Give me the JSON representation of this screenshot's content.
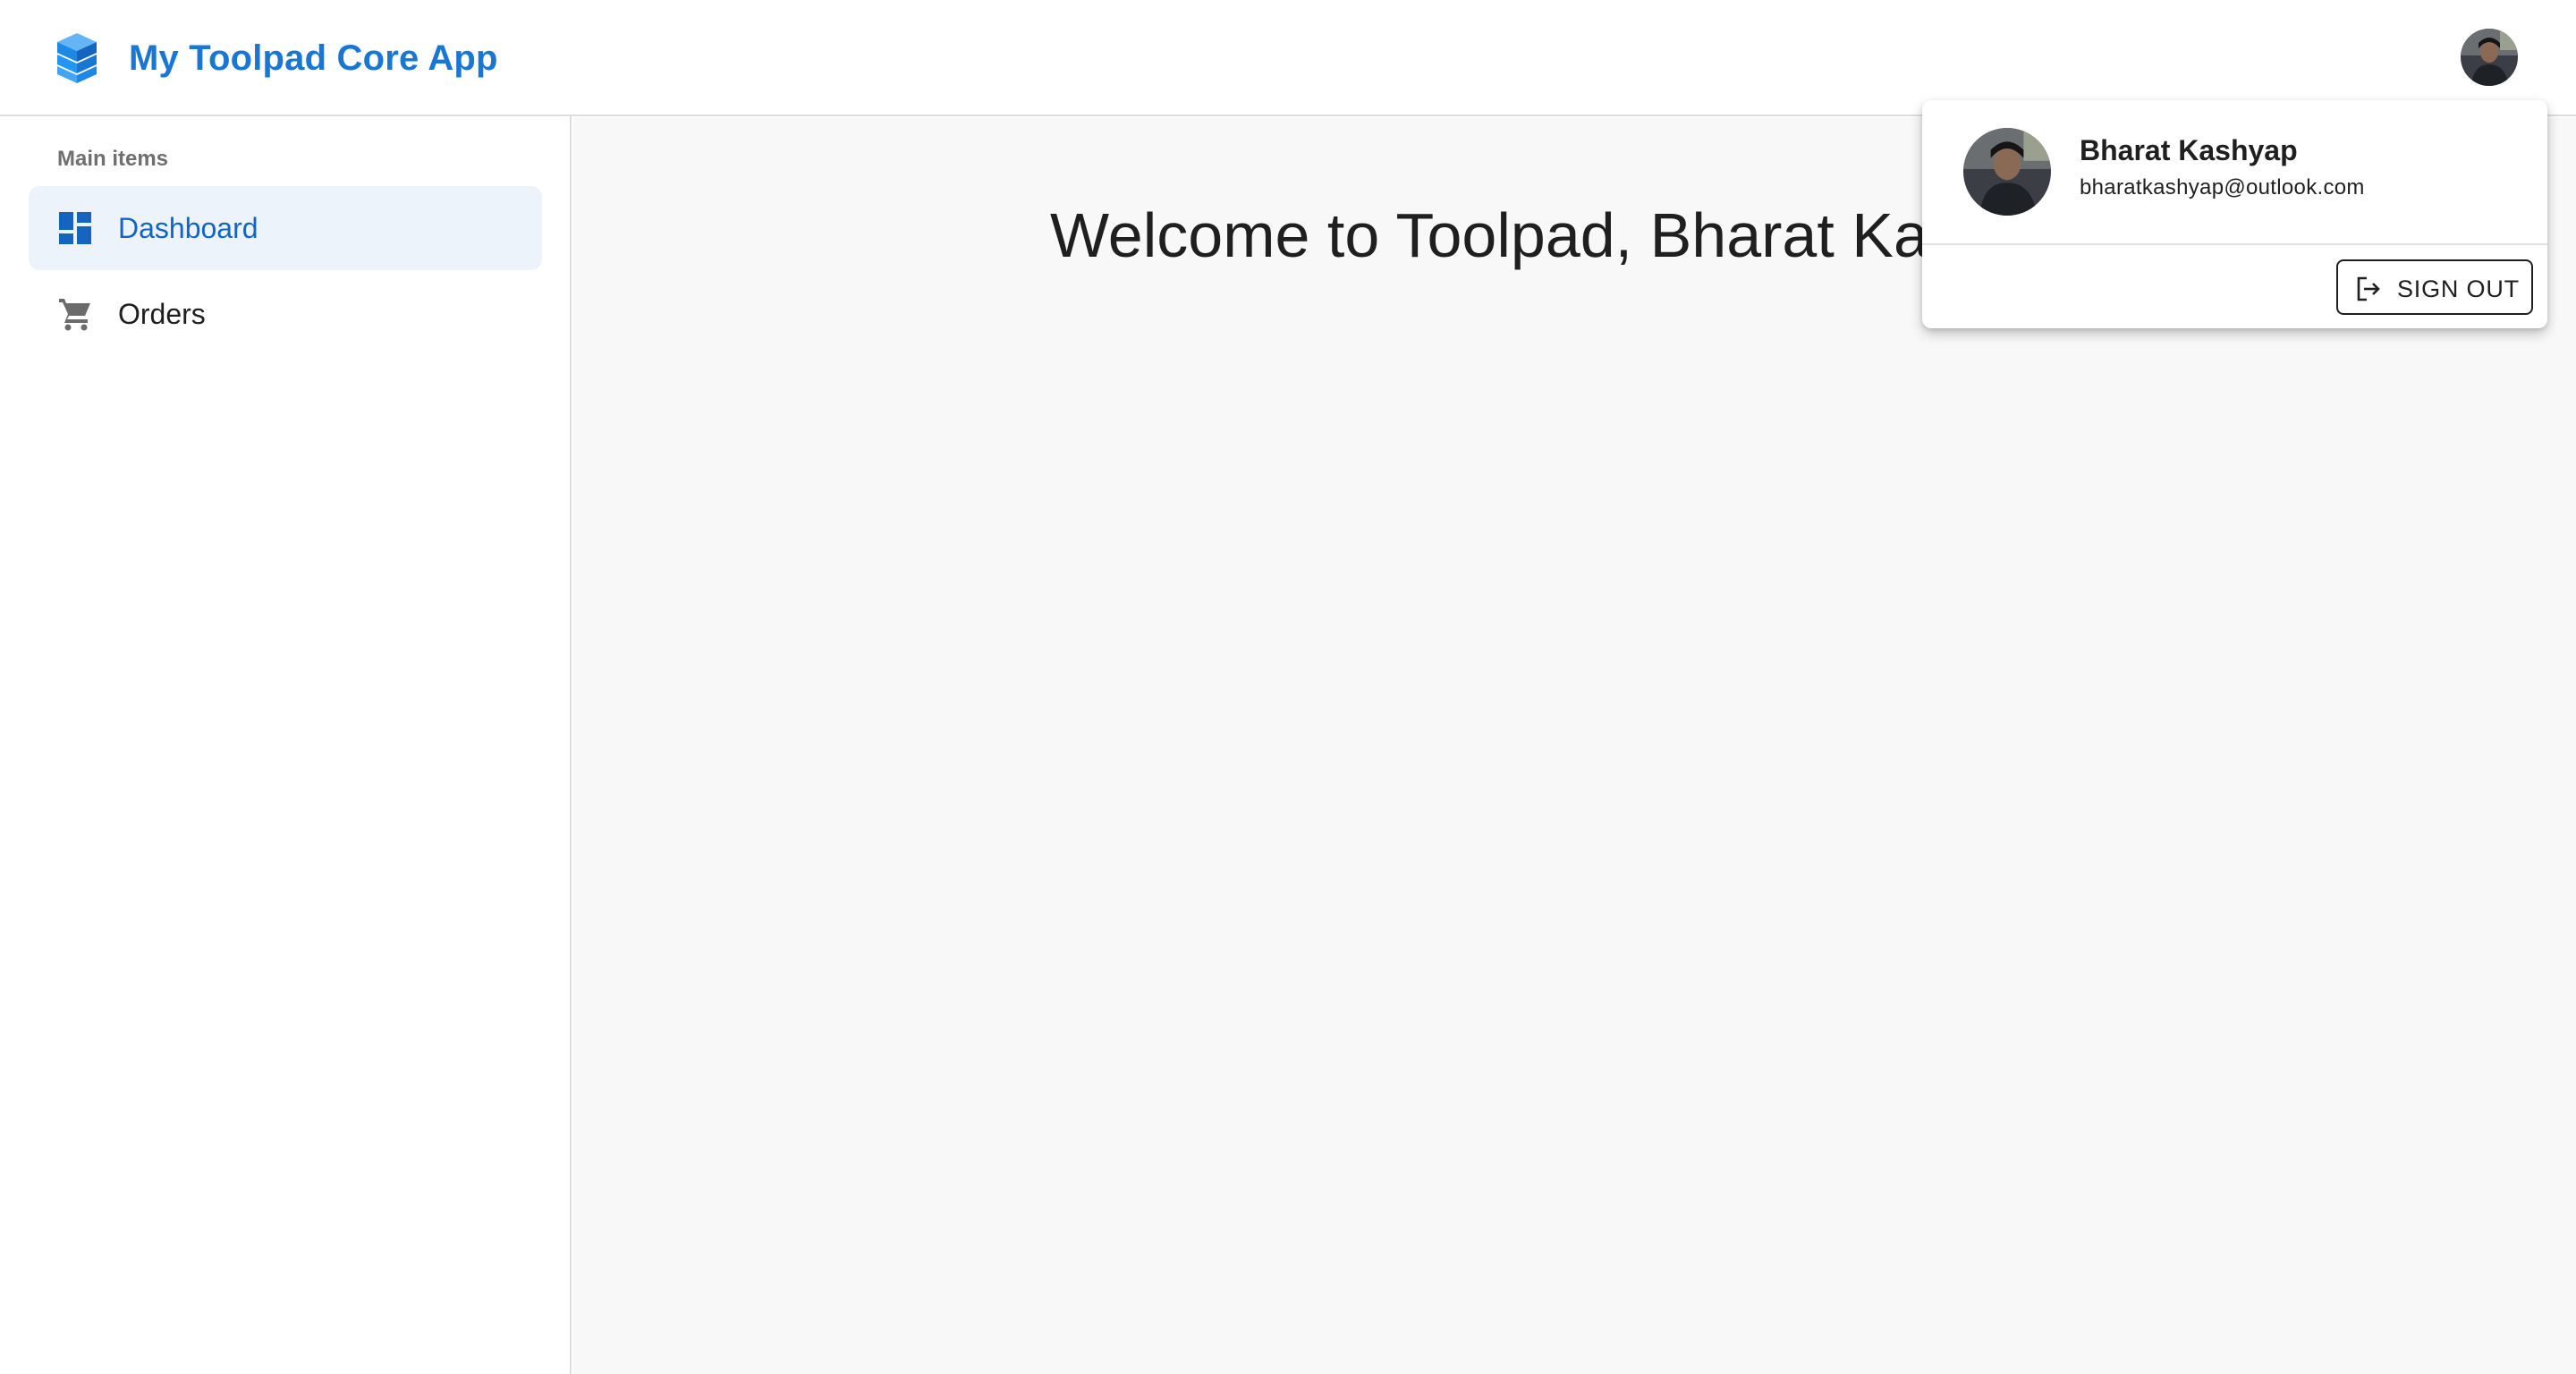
{
  "app": {
    "title": "My Toolpad Core App",
    "logo_icon": "stacked-cubes-icon",
    "brand_color": "#1976d2"
  },
  "header": {
    "avatar_icon": "user-avatar-photo"
  },
  "sidebar": {
    "section_label": "Main items",
    "items": [
      {
        "label": "Dashboard",
        "icon": "dashboard-icon",
        "active": true
      },
      {
        "label": "Orders",
        "icon": "shopping-cart-icon",
        "active": false
      }
    ],
    "active_bg": "#edf3fb",
    "active_color": "#1565c0"
  },
  "main": {
    "welcome_text": "Welcome to Toolpad, Bharat Kashyap"
  },
  "account_popover": {
    "name": "Bharat Kashyap",
    "email": "bharatkashyap@outlook.com",
    "sign_out_label": "SIGN OUT",
    "sign_out_icon": "logout-icon"
  }
}
